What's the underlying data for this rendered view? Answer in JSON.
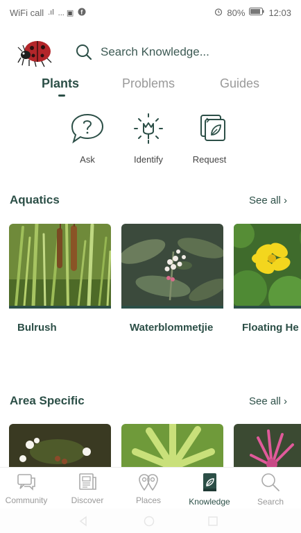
{
  "status": {
    "carrier": "WiFi call",
    "signal": ".ıl",
    "extras": "... ▣",
    "battery": "80%",
    "time": "12:03"
  },
  "search": {
    "placeholder": "Search Knowledge..."
  },
  "tabs": [
    {
      "label": "Plants",
      "active": true
    },
    {
      "label": "Problems",
      "active": false
    },
    {
      "label": "Guides",
      "active": false
    }
  ],
  "actions": [
    {
      "label": "Ask",
      "icon": "question-bubble-icon"
    },
    {
      "label": "Identify",
      "icon": "identify-flower-icon"
    },
    {
      "label": "Request",
      "icon": "request-cards-icon"
    }
  ],
  "sections": {
    "aquatics": {
      "title": "Aquatics",
      "see_all": "See all ›",
      "items": [
        {
          "name": "Bulrush"
        },
        {
          "name": "Waterblommetjie"
        },
        {
          "name": "Floating He"
        }
      ]
    },
    "area_specific": {
      "title": "Area Specific",
      "see_all": "See all ›"
    }
  },
  "bottom_nav": [
    {
      "label": "Community",
      "icon": "community-chat-icon",
      "active": false
    },
    {
      "label": "Discover",
      "icon": "discover-news-icon",
      "active": false
    },
    {
      "label": "Places",
      "icon": "places-pins-icon",
      "active": false
    },
    {
      "label": "Knowledge",
      "icon": "knowledge-book-icon",
      "active": true
    },
    {
      "label": "Search",
      "icon": "search-icon",
      "active": false
    }
  ],
  "colors": {
    "brand": "#2c4f47",
    "muted": "#999999"
  }
}
